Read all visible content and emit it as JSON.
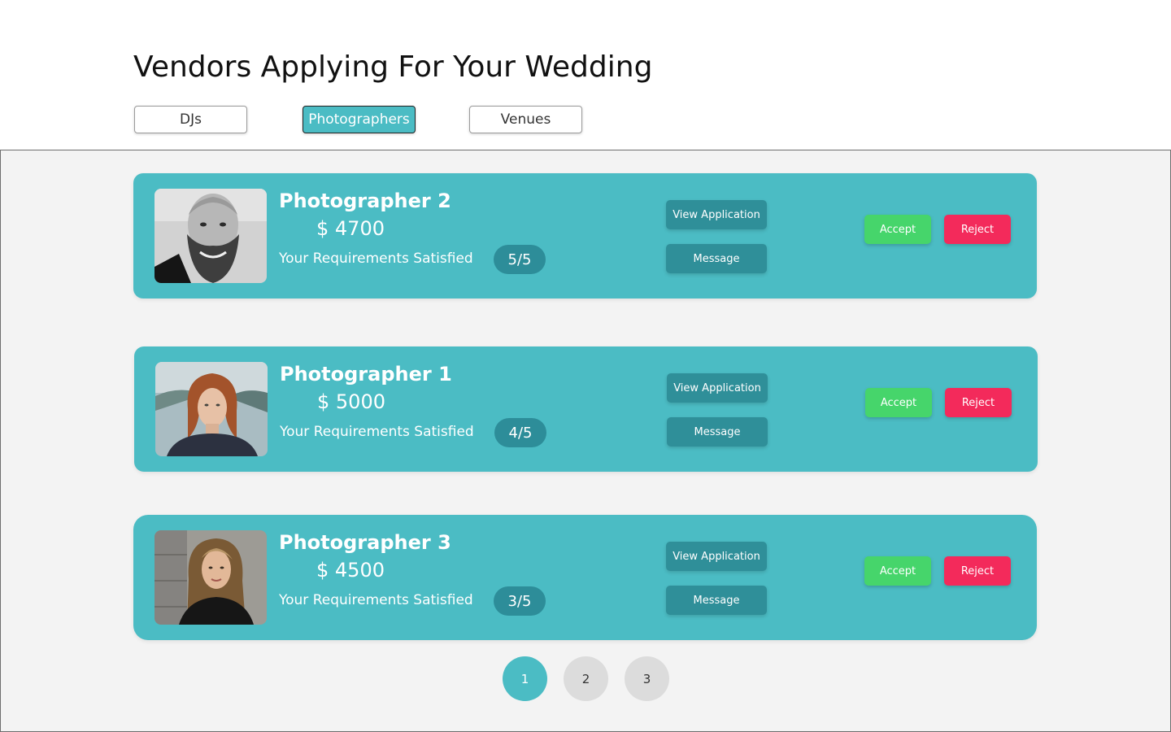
{
  "page": {
    "title": "Vendors Applying For Your Wedding"
  },
  "tabs": [
    {
      "label": "DJs",
      "active": false
    },
    {
      "label": "Photographers",
      "active": true
    },
    {
      "label": "Venues",
      "active": false
    }
  ],
  "vendors": [
    {
      "name": "Photographer 2",
      "price": "$ 4700",
      "requirements_label": "Your Requirements Satisfied",
      "score": "5/5",
      "view_label": "View Application",
      "message_label": "Message",
      "accept_label": "Accept",
      "reject_label": "Reject"
    },
    {
      "name": "Photographer 1",
      "price": "$ 5000",
      "requirements_label": "Your Requirements Satisfied",
      "score": "4/5",
      "view_label": "View Application",
      "message_label": "Message",
      "accept_label": "Accept",
      "reject_label": "Reject"
    },
    {
      "name": "Photographer 3",
      "price": "$ 4500",
      "requirements_label": "Your Requirements Satisfied",
      "score": "3/5",
      "view_label": "View Application",
      "message_label": "Message",
      "accept_label": "Accept",
      "reject_label": "Reject"
    }
  ],
  "pagination": {
    "pages": [
      "1",
      "2",
      "3"
    ],
    "current": "1"
  },
  "colors": {
    "accent": "#4bbcc4",
    "dark_accent": "#2f8f99",
    "accept": "#46d56b",
    "reject": "#f32a5b",
    "panel_background": "#f3f3f3"
  }
}
